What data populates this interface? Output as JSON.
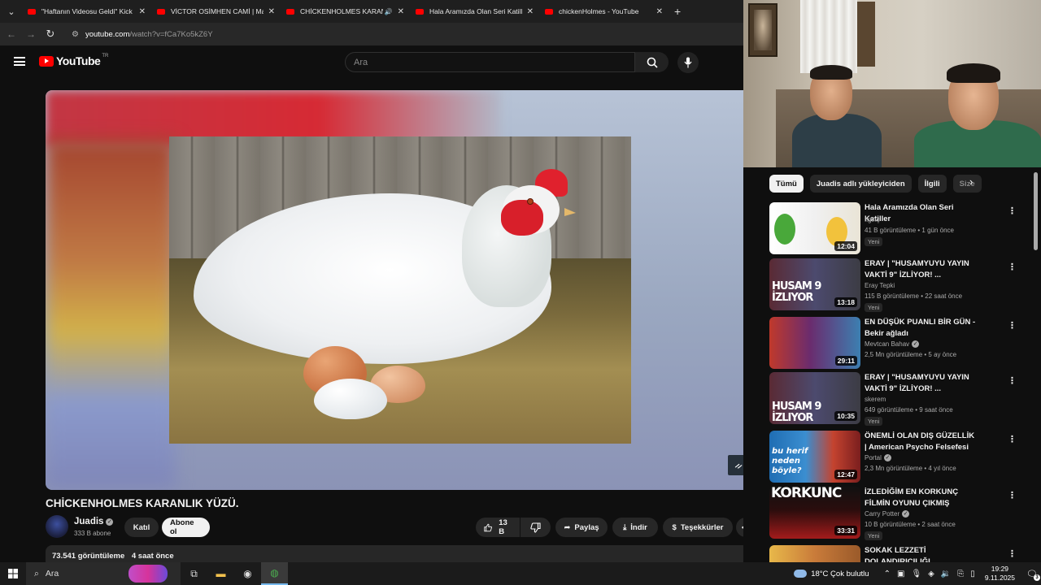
{
  "browser": {
    "tabs": [
      {
        "title": "\"Haftanın Videosu Geldi\" Kick & ..."
      },
      {
        "title": "VİCTOR OSİMHEN CAMİ | Madı..."
      },
      {
        "title": "CHİCKENHOLMES KARANLIK..."
      },
      {
        "title": "Hala Aramızda Olan Seri Katiller"
      },
      {
        "title": "chickenHolmes - YouTube"
      }
    ],
    "url_host": "youtube.com",
    "url_path": "/watch?v=fCa7Ko5kZ6Y"
  },
  "youtube": {
    "logo_text": "YouTube",
    "country_code": "TR",
    "search_placeholder": "Ara",
    "video": {
      "title": "CHİCKENHOLMES KARANLIK YÜZÜ.",
      "channel": "Juadis",
      "subscribers": "333 B abone",
      "join_label": "Katıl",
      "subscribe_label": "Abone ol",
      "likes": "13 B",
      "share_label": "Paylaş",
      "download_label": "İndir",
      "thanks_label": "Teşekkürler",
      "views": "73.541 görüntüleme",
      "posted": "4 saat önce"
    },
    "chips": [
      "Tümü",
      "Juadis adlı yükleyiciden",
      "İlgili",
      "Size"
    ],
    "recommendations": [
      {
        "title": "Hala Aramızda Olan Seri Katiller",
        "channel": "İlginç",
        "meta": "41 B görüntüleme • 1 gün önce",
        "badge": "Yeni",
        "duration": "12:04",
        "verified": false
      },
      {
        "title": "ERAY | \"HUSAMYUYU YAYIN VAKTİ 9\" İZLİYOR! ...",
        "channel": "Eray Tepki",
        "meta": "115 B görüntüleme • 22 saat önce",
        "badge": "Yeni",
        "duration": "13:18",
        "verified": false,
        "overlay": "HUSAM 9 İZLIYOR"
      },
      {
        "title": "EN DÜŞÜK PUANLI BİR GÜN - Bekir ağladı",
        "channel": "Mevtcan Bahav",
        "meta": "2,5 Mn görüntüleme • 5 ay önce",
        "badge": "",
        "duration": "29:11",
        "verified": true
      },
      {
        "title": "ERAY | \"HUSAMYUYU YAYIN VAKTİ 9\" İZLİYOR! ...",
        "channel": "skerem",
        "meta": "649 görüntüleme • 9 saat önce",
        "badge": "Yeni",
        "duration": "10:35",
        "verified": false,
        "overlay": "HUSAM 9 İZLIYOR"
      },
      {
        "title": "ÖNEMLİ OLAN DIŞ GÜZELLİK | American Psycho Felsefesi",
        "channel": "Portal",
        "meta": "2,3 Mn görüntüleme • 4 yıl önce",
        "badge": "",
        "duration": "12:47",
        "verified": true,
        "overlay": "bu herif neden böyle?"
      },
      {
        "title": "İZLEDİĞİM EN KORKUNÇ FİLMİN OYUNU ÇIKMIŞ",
        "channel": "Carry Potter",
        "meta": "10 B görüntüleme • 2 saat önce",
        "badge": "Yeni",
        "duration": "33:31",
        "verified": true,
        "overlay": "KORKUNC"
      },
      {
        "title": "SOKAK LEZZETİ DOLANDIRICILIĞI.",
        "channel": "",
        "meta": "",
        "badge": "",
        "duration": "",
        "verified": false
      }
    ]
  },
  "taskbar": {
    "search_placeholder": "Ara",
    "weather": "18°C  Çok bulutlu",
    "time": "19:29",
    "date": "9.11.2025",
    "notifications": "3"
  },
  "colors": {
    "youtube_red": "#ff0000",
    "page_bg": "#0f0f0f",
    "chip_bg": "#272727"
  }
}
